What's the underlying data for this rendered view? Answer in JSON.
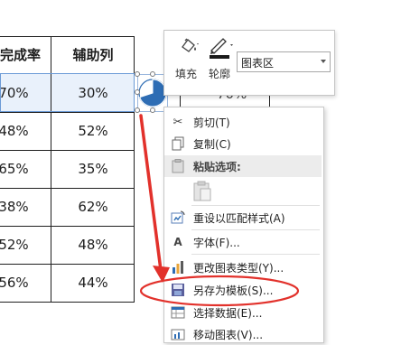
{
  "table": {
    "headers": [
      "完成率",
      "辅助列"
    ],
    "rows": [
      [
        "70%",
        "30%"
      ],
      [
        "48%",
        "52%"
      ],
      [
        "65%",
        "35%"
      ],
      [
        "38%",
        "62%"
      ],
      [
        "52%",
        "48%"
      ],
      [
        "56%",
        "44%"
      ]
    ]
  },
  "behind_cell": "70%",
  "chart": {
    "type": "pie",
    "filled_fraction": 0.7,
    "color": "#2e6db4"
  },
  "mini_toolbar": {
    "fill_label": "填充",
    "outline_label": "轮廓",
    "element_select": "图表区"
  },
  "context_menu": {
    "items": [
      {
        "icon": "scissors-icon",
        "label": "剪切(T)"
      },
      {
        "icon": "copy-icon",
        "label": "复制(C)"
      },
      {
        "icon": "clipboard-icon",
        "label": "粘贴选项:"
      },
      {
        "icon": "reset-style-icon",
        "label": "重设以匹配样式(A)"
      },
      {
        "icon": "font-icon",
        "label": "字体(F)..."
      },
      {
        "icon": "chart-type-icon",
        "label": "更改图表类型(Y)..."
      },
      {
        "icon": "save-template-icon",
        "label": "另存为模板(S)..."
      },
      {
        "icon": "select-data-icon",
        "label": "选择数据(E)..."
      },
      {
        "icon": "move-chart-icon",
        "label": "移动图表(V)..."
      }
    ]
  },
  "colors": {
    "annotation_red": "#e2312b",
    "accent_blue": "#2e6db4",
    "selection_fill": "#e9f1fb"
  }
}
